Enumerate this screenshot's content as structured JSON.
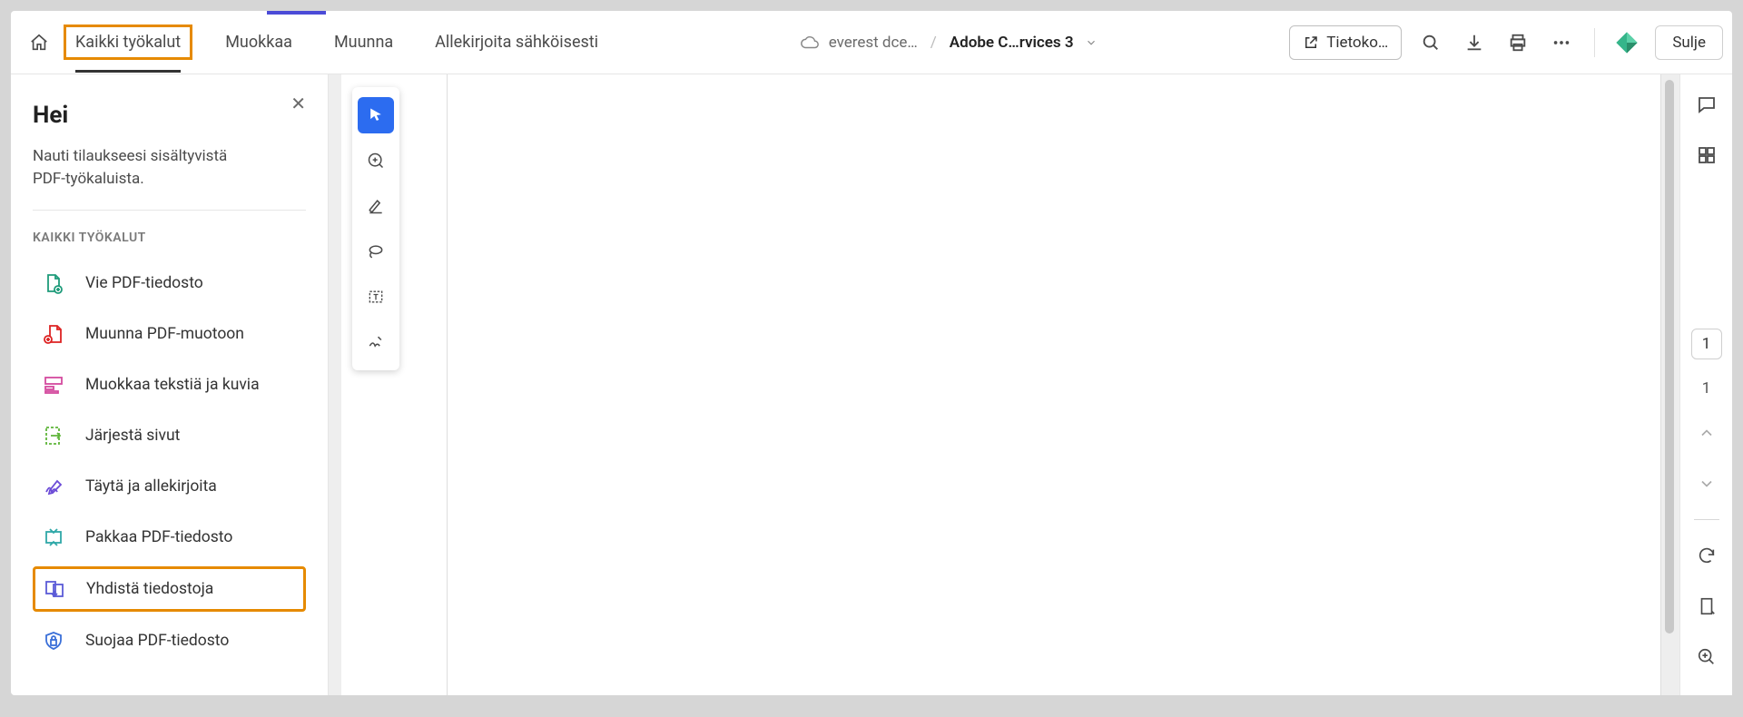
{
  "topbar": {
    "nav": {
      "all_tools": "Kaikki työkalut",
      "edit": "Muokkaa",
      "convert": "Muunna",
      "esign": "Allekirjoita sähköisesti"
    },
    "cloud_file": "everest dce…",
    "doc_name": "Adobe C…rvices 3",
    "info_button": "Tietoko…",
    "close": "Sulje"
  },
  "sidebar": {
    "title": "Hei",
    "subtitle": "Nauti tilaukseesi sisältyvistä PDF-työkaluista.",
    "section": "KAIKKI TYÖKALUT",
    "tools": [
      {
        "label": "Vie PDF-tiedosto"
      },
      {
        "label": "Muunna PDF-muotoon"
      },
      {
        "label": "Muokkaa tekstiä ja kuvia"
      },
      {
        "label": "Järjestä sivut"
      },
      {
        "label": "Täytä ja allekirjoita"
      },
      {
        "label": "Pakkaa PDF-tiedosto"
      },
      {
        "label": "Yhdistä tiedostoja"
      },
      {
        "label": "Suojaa PDF-tiedosto"
      }
    ]
  },
  "rail": {
    "page_total": "1",
    "page_current": "1"
  }
}
